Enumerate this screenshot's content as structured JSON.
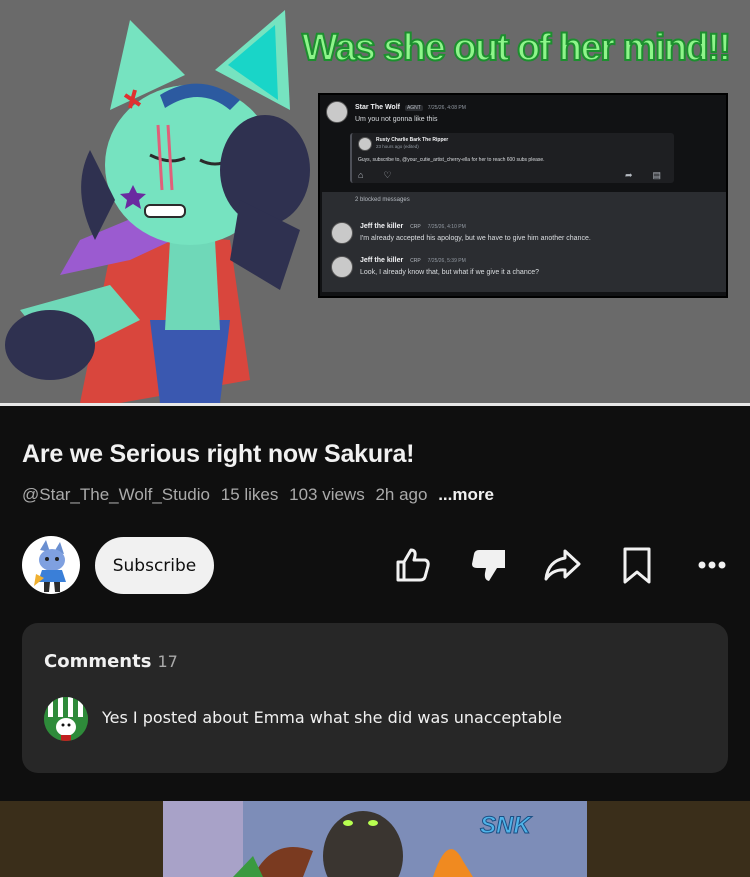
{
  "media": {
    "caption": "Was she out of her mind!!",
    "discord": {
      "main_author": "Star The Wolf",
      "main_tag": "AGNT",
      "main_time": "7/25/26, 4:08 PM",
      "main_text": "Um you not gonna like this",
      "forward_author": "Rusty Charlie Bark The Ripper",
      "forward_time": "23 hours ago (edited)",
      "forward_text": "Guys, subscribe to, @your_cutie_artist_cherry-ella for her to reach 600 subs please.",
      "blocked_label": "2 blocked messages",
      "reply1_author": "Jeff the killer",
      "reply1_tag": "CRP",
      "reply1_time": "7/25/26, 4:10 PM",
      "reply1_text": "I'm already accepted his apology, but we have to give him another chance.",
      "reply2_author": "Jeff the killer",
      "reply2_tag": "CRP",
      "reply2_time": "7/25/26, 5:39 PM",
      "reply2_text": "Look, I already know that, but what if we give it a chance?"
    }
  },
  "video": {
    "title": "Are we Serious right now Sakura!",
    "channel": "@Star_The_Wolf_Studio",
    "likes": "15 likes",
    "views": "103 views",
    "age": "2h ago",
    "more": "...more"
  },
  "actions": {
    "subscribe_label": "Subscribe",
    "icons": [
      "thumb-up-icon",
      "thumb-down-icon",
      "share-icon",
      "save-icon",
      "more-icon"
    ]
  },
  "comments": {
    "heading": "Comments",
    "count": "17",
    "top_comment": "Yes I posted about Emma what she did was unacceptable"
  },
  "next_video": {
    "logo_text": "SNK"
  },
  "colors": {
    "background": "#0f0f0f",
    "card": "#272727",
    "caption_green": "#8ef58a",
    "subscribe_bg": "#f1f1f1"
  }
}
